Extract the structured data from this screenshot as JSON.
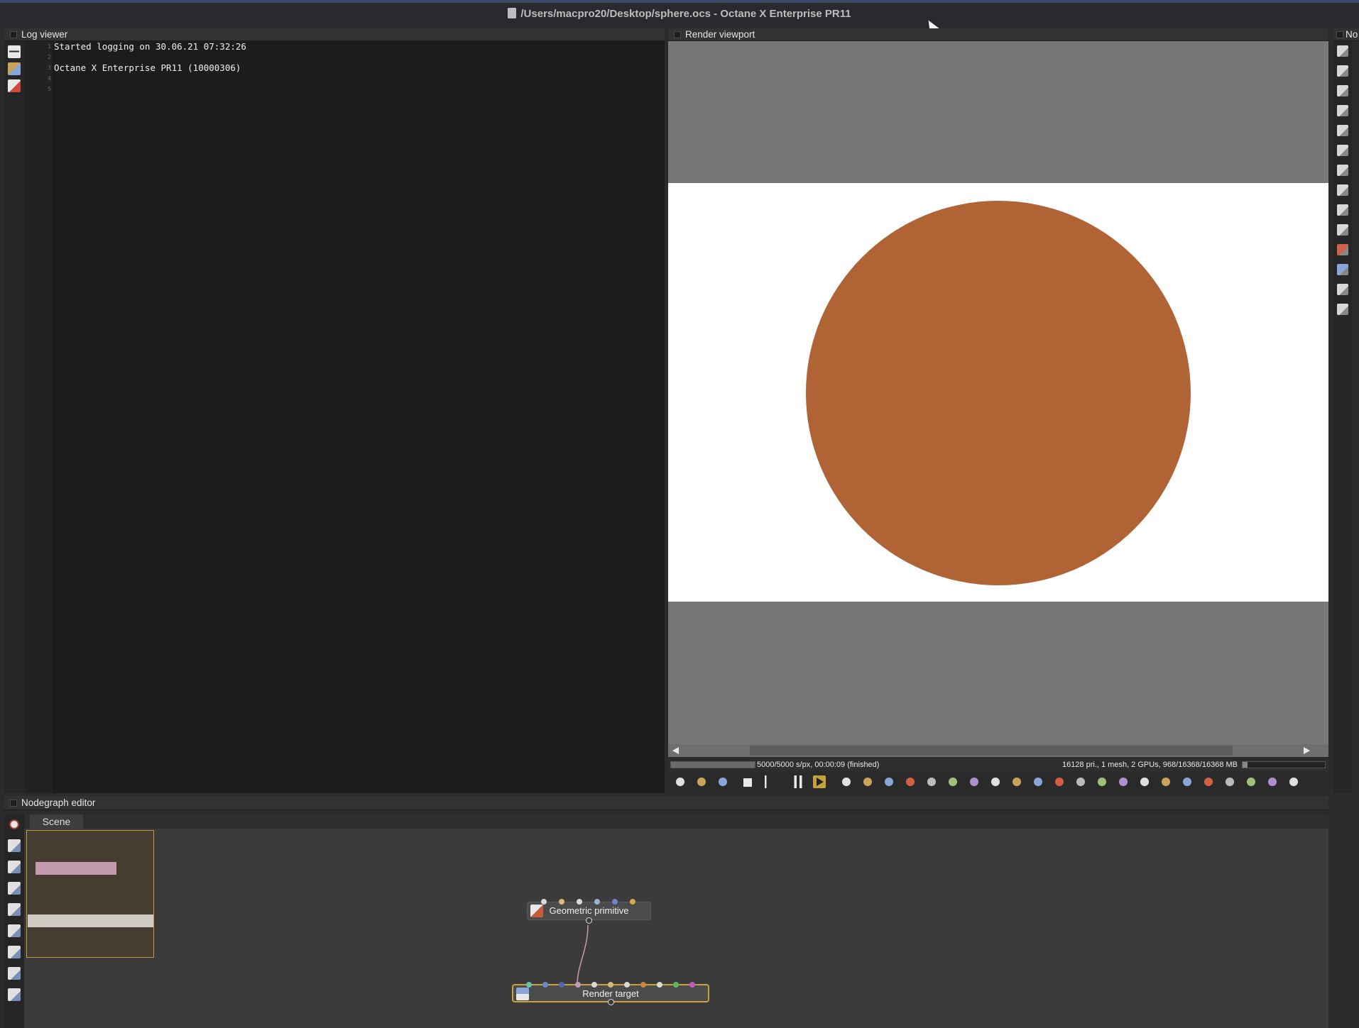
{
  "window": {
    "title": "/Users/macpro20/Desktop/sphere.ocs - Octane X Enterprise PR11"
  },
  "log_viewer": {
    "header": "Log viewer",
    "lines": [
      {
        "num": "1",
        "text": "Started logging on 30.06.21 07:32:26"
      },
      {
        "num": "2",
        "text": ""
      },
      {
        "num": "3",
        "text": "Octane X Enterprise PR11 (10000306)"
      },
      {
        "num": "4",
        "text": ""
      },
      {
        "num": "5",
        "text": ""
      }
    ],
    "toolbar_icons": [
      "save-icon",
      "copy-icon",
      "clear-log-icon"
    ]
  },
  "render_viewport": {
    "header": "Render viewport",
    "status_left": "5000/5000 s/px, 00:00:09 (finished)",
    "status_right": "16128 pri., 1 mesh, 2 GPUs, 968/16368/16368 MB",
    "progress": 1.0,
    "memory_usage": 0.06,
    "sphere_color": "#b06335",
    "background_color": "#777777",
    "toolbar_icons": [
      "render-settings-icon",
      "region-render-icon",
      "cube-icon",
      "stop-icon",
      "restart-icon",
      "pause-icon",
      "play-icon",
      "display-icon",
      "text-icon",
      "color-wheel-icon",
      "refresh-icon",
      "picker-icon",
      "pick-focus-icon",
      "pick-white-icon",
      "region-icon",
      "zoom-icon",
      "frame-icon",
      "light-icon",
      "copy-icon",
      "export-icon",
      "layers-icon",
      "checker-icon",
      "shield-icon",
      "lock-icon",
      "camera-view-icon",
      "move-icon",
      "rotate-icon",
      "fullscreen-icon",
      "axis-icon"
    ]
  },
  "right_panel": {
    "header": "No",
    "icons": [
      "outliner-icon",
      "list-icon",
      "image-icon",
      "material-icon",
      "mesh-icon",
      "texture-icon",
      "geometry-icon",
      "frame-icon",
      "clock-icon",
      "graph-icon",
      "cube-red-icon",
      "cube-blue-icon",
      "picture-icon",
      "sun-icon"
    ]
  },
  "nodegraph": {
    "header": "Nodegraph editor",
    "tab": "Scene",
    "left_icons": [
      "render-settings-icon",
      "node-tree-icon",
      "node-grid-icon",
      "image-node-icon",
      "geometry-icon",
      "texture-icon",
      "material-icon",
      "layout-icon",
      "table-icon"
    ],
    "nodes": {
      "geometric_primitive": "Geometric primitive",
      "render_target": "Render target"
    },
    "geo_pin_colors": [
      "#d9d9d9",
      "#d8b980",
      "#d9d9d9",
      "#9fb2d0",
      "#6b86c9",
      "#d6a94a"
    ],
    "rt_pin_colors": [
      "#66c2a5",
      "#6b86c9",
      "#4c6ab0",
      "#c49ab0",
      "#d9d9d9",
      "#d8b980",
      "#d9d9d9",
      "#c9873c",
      "#d9d9d9",
      "#5cb85c",
      "#c05cc0"
    ]
  }
}
